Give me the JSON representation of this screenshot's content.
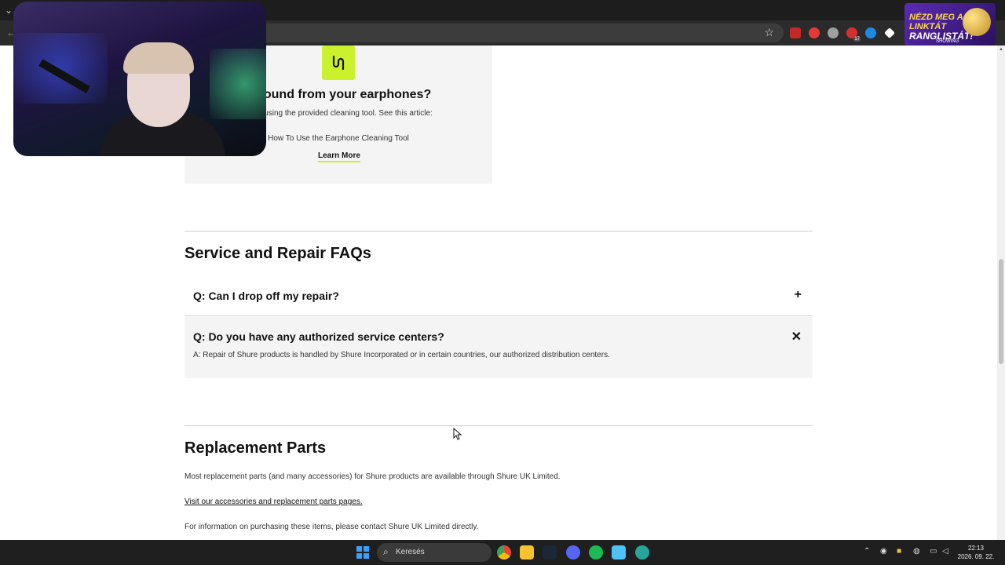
{
  "browser": {
    "icons": [
      "chevron-down-icon",
      "back-arrow-icon",
      "bookmark-star-icon"
    ],
    "extension_colors": [
      "#c62828",
      "#e53935",
      "#9e9e9e",
      "#d32f2f",
      "#1e88e5",
      "#ffffff"
    ],
    "extension_badge": "17"
  },
  "promo": {
    "line1": "NÉZD MEG A LINKTÁT",
    "line2": "RANGLISTÁT!",
    "sub": "SHOWING"
  },
  "card": {
    "title": "o sound from your earphones?",
    "text": "them using the provided cleaning tool. See this article:",
    "article": "How To Use the Earphone Cleaning Tool",
    "learn_more": "Learn More",
    "icon": "earphones-icon",
    "accent": "#c9f12e"
  },
  "faqs": {
    "title": "Service and Repair FAQs",
    "items": [
      {
        "question": "Q: Can I drop off my repair?",
        "toggle": "+",
        "answer": ""
      },
      {
        "question": "Q: Do you have any authorized service centers?",
        "toggle": "✕",
        "answer": "A: Repair of Shure products is handled by Shure Incorporated or in certain countries, our authorized distribution centers."
      }
    ]
  },
  "parts": {
    "title": "Replacement Parts",
    "p1": "Most replacement parts (and many accessories) for Shure products are available through Shure UK Limited.",
    "link": "Visit our accessories and replacement parts pages.",
    "p2": "For information on purchasing these items, please contact Shure UK Limited directly."
  },
  "taskbar": {
    "search_label": "Keresés",
    "apps": [
      "chrome-icon",
      "file-explorer-icon",
      "steam-icon",
      "discord-icon",
      "spotify-icon",
      "notepad-icon",
      "browser-icon"
    ],
    "tray_icons": [
      "chevron-up-icon",
      "steam-tray-icon",
      "folder-tray-icon",
      "discord-tray-icon",
      "network-icon",
      "volume-icon"
    ],
    "time": "22:13",
    "date": "2026. 09. 22."
  }
}
